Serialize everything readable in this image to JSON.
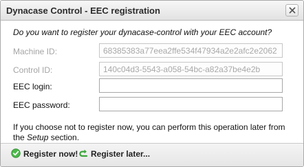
{
  "window": {
    "title": "Dynacase Control - EEC registration"
  },
  "form": {
    "question": "Do you want to register your dynacase-control with your EEC account?",
    "machine_id": {
      "label": "Machine ID:",
      "value": "68385383a77eea2ffe534f47934a2e2afc2e2062"
    },
    "control_id": {
      "label": "Control ID:",
      "value": "140c04d3-5543-a058-54bc-a82a37be4e2b"
    },
    "eec_login": {
      "label": "EEC login:",
      "value": ""
    },
    "eec_password": {
      "label": "EEC password:",
      "value": ""
    },
    "note_before": "If you choose not to register now, you can perform this operation later from the ",
    "note_link": "Setup",
    "note_after": " section."
  },
  "footer": {
    "register_now": {
      "label": "Register now!",
      "icon": "check-circle-icon",
      "color": "#3aa53a"
    },
    "register_later": {
      "label": "Register later...",
      "icon": "redo-arrow-icon",
      "color": "#3aa53a"
    }
  }
}
